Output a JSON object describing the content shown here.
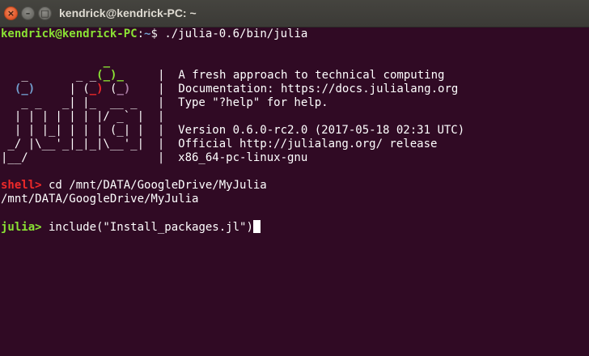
{
  "window": {
    "title": "kendrick@kendrick-PC: ~",
    "close_glyph": "×",
    "minimize_glyph": "–",
    "maximize_glyph": "□"
  },
  "terminal": {
    "prompt_user_host": "kendrick@kendrick-PC",
    "prompt_path": ":~",
    "prompt_symbol": "$ ",
    "command": "./julia-0.6/bin/julia",
    "banner_lines": [
      "               _      ",
      "   _       _ _(_)_     |  A fresh approach to technical computing",
      "  (_)     | (_) (_)    |  Documentation: https://docs.julialang.org",
      "   _ _   _| |_  __ _   |  Type \"?help\" for help.",
      "  | | | | | | |/ _` |  |",
      "  | | |_| | | | (_| |  |  Version 0.6.0-rc2.0 (2017-05-18 02:31 UTC)",
      " _/ |\\__'_|_|_|\\__'_|  |  Official http://julialang.org/ release",
      "|__/                   |  x86_64-pc-linux-gnu"
    ],
    "shell_prompt": "shell>",
    "shell_command": " cd /mnt/DATA/GoogleDrive/MyJulia",
    "shell_output": "/mnt/DATA/GoogleDrive/MyJulia",
    "julia_prompt": "julia>",
    "julia_command": " include(\"Install_packages.jl\")"
  },
  "colors": {
    "background": "#300a24",
    "prompt_green": "#8ae234",
    "prompt_blue": "#729fcf",
    "shell_red": "#ef2929",
    "julia_green": "#8ae234",
    "logo_blue": "#729fcf",
    "logo_red": "#ef2929",
    "logo_green": "#8ae234",
    "logo_purple": "#ad7fa8"
  }
}
